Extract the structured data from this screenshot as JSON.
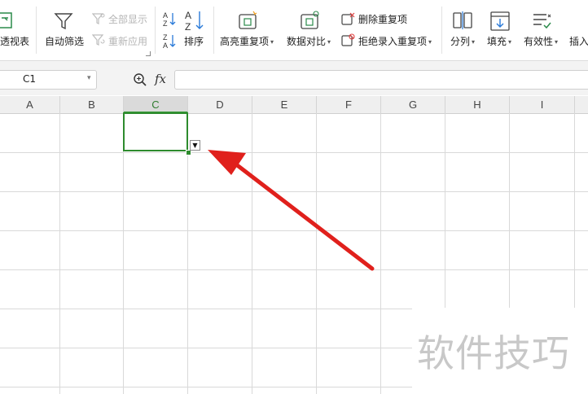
{
  "ribbon": {
    "pivot_label": "透视表",
    "autofilter_label": "自动筛选",
    "show_all_label": "全部显示",
    "reapply_label": "重新应用",
    "sort_label": "排序",
    "highlight_dup_label": "高亮重复项",
    "compare_label": "数据对比",
    "remove_dup_label": "删除重复项",
    "reject_dup_label": "拒绝录入重复项",
    "split_label": "分列",
    "fill_label": "填充",
    "validity_label": "有效性",
    "insert_label": "插入"
  },
  "formula_bar": {
    "name_box": "C1",
    "fx": "fx",
    "formula": ""
  },
  "columns": [
    "A",
    "B",
    "C",
    "D",
    "E",
    "F",
    "G",
    "H",
    "I"
  ],
  "selected_column": "C",
  "active_cell": "C1",
  "watermark": "软件技巧",
  "colors": {
    "selection_green": "#2e8b2e",
    "arrow_red": "#e0201c"
  }
}
